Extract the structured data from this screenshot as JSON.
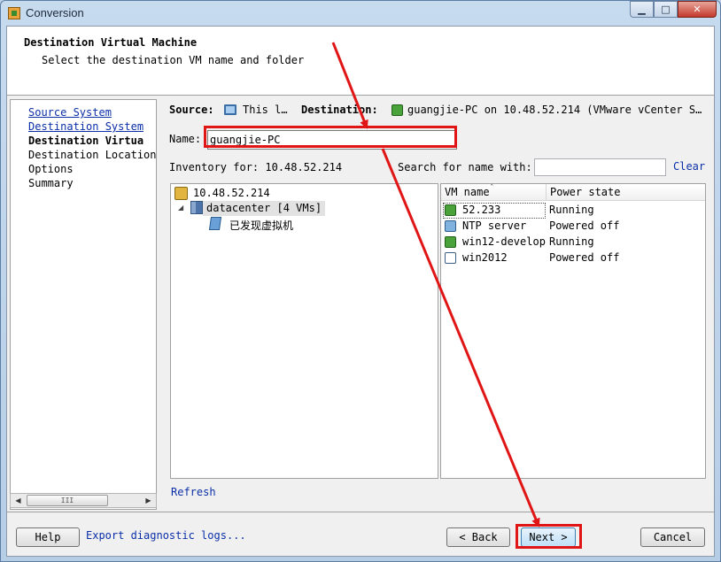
{
  "window": {
    "title": "Conversion",
    "controls": {
      "minimize": "▁",
      "maximize": "□",
      "close": "✕"
    }
  },
  "header": {
    "title": "Destination Virtual Machine",
    "subtitle": "Select the destination VM name and folder"
  },
  "nav": {
    "items": [
      {
        "label": "Source System",
        "style": "link"
      },
      {
        "label": "Destination System",
        "style": "link"
      },
      {
        "label": "Destination Virtua",
        "style": "current"
      },
      {
        "label": "Destination Location",
        "style": "plain"
      },
      {
        "label": "Options",
        "style": "plain"
      },
      {
        "label": "Summary",
        "style": "plain"
      }
    ],
    "scroll_thumb": "III"
  },
  "summary_bar": {
    "source_label": "Source:",
    "source_value": "This l…",
    "destination_label": "Destination:",
    "destination_value": "guangjie-PC on 10.48.52.214 (VMware vCenter S…"
  },
  "name_field": {
    "label": "Name:",
    "value": "guangjie-PC"
  },
  "inventory": {
    "label": "Inventory for: 10.48.52.214",
    "search_label": "Search for name with:",
    "search_value": "",
    "clear_label": "Clear",
    "refresh_label": "Refresh"
  },
  "tree": {
    "host": "10.48.52.214",
    "datacenter": "datacenter [4 VMs]",
    "folder": "已发现虚拟机"
  },
  "vm_grid": {
    "columns": [
      "VM name",
      "Power state"
    ],
    "rows": [
      {
        "name": "52.233",
        "state": "Running",
        "icon": "vm-running-icon"
      },
      {
        "name": "NTP server",
        "state": "Powered off",
        "icon": "vm-off-icon"
      },
      {
        "name": "win12-develop",
        "state": "Running",
        "icon": "vm-running-icon"
      },
      {
        "name": "win2012",
        "state": "Powered off",
        "icon": "vm-template-icon"
      }
    ]
  },
  "footer": {
    "help": "Help",
    "export": "Export diagnostic logs...",
    "back": "< Back",
    "next": "Next >",
    "cancel": "Cancel"
  },
  "colors": {
    "accent_link": "#0b2fa8",
    "annotation_red": "#e01515"
  }
}
